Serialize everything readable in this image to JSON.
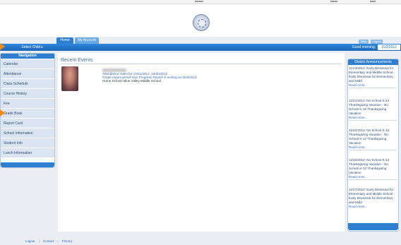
{
  "header": {
    "logo": "district-seal-icon"
  },
  "tabs": [
    {
      "label": "Home",
      "active": true
    },
    {
      "label": "My Account",
      "active": false
    }
  ],
  "utility": {
    "help": "Help",
    "logout": "Logout"
  },
  "bar": {
    "select_child": "Select Child ▸",
    "greeting": "Good morning,",
    "date": "11/2/2012"
  },
  "sidebar": {
    "header": "Navigation",
    "items": [
      {
        "label": "Calendar"
      },
      {
        "label": "Attendance"
      },
      {
        "label": "Class Schedule"
      },
      {
        "label": "Course History"
      },
      {
        "label": "Fee"
      },
      {
        "label": "Grade Book"
      },
      {
        "label": "Report Card"
      },
      {
        "label": "School Information"
      },
      {
        "label": "Student Info"
      },
      {
        "label": "Lunch Information"
      }
    ]
  },
  "recent_events": {
    "title": "Recent Events",
    "lines": [
      "Attendance notes for 10/31/2012, 10/30/2012",
      "Grade report period 'Nov Progress Report' is ending on 11/9/2012",
      "Home School: Blue Valley Middle School"
    ]
  },
  "announcements": {
    "title": "District Announcements",
    "items": [
      {
        "text": "11/13/2012: Early Dismissal for Elementary and Middle School - Early Dismissal for Elementary and Midd",
        "more": "Read more..."
      },
      {
        "text": "11/21/2012: No School K-12 Thanksgiving Vacation - No School K-12 Thanksgiving Vacation",
        "more": "Read more..."
      },
      {
        "text": "11/22/2012: No School K-12 Thanksgiving Vacation - No School K-12 Thanksgiving Vacation",
        "more": "Read more..."
      },
      {
        "text": "11/23/2012: No School K-12 Thanksgiving Vacation - No School K-12 Thanksgiving Vacation",
        "more": "Read more..."
      },
      {
        "text": "11/27/2012: Early Dismissal for Elementary and Middle School - Early Dismissal for Elementary and Midd",
        "more": "Read more..."
      }
    ]
  },
  "footer": {
    "links": [
      "Logout",
      "Contact",
      "Privacy"
    ],
    "separator": "|"
  },
  "colors": {
    "accent": "#2f7fd0",
    "annotation_arrow": "#f08a14"
  }
}
